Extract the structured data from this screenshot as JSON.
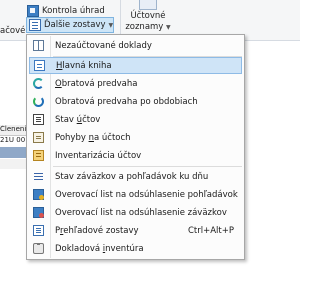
{
  "ribbon": {
    "kontrola_label": "Kontrola úhrad",
    "dalsie_label": "Ďalšie zostavy",
    "uctove_line1": "Účtovné",
    "uctove_line2": "zoznamy",
    "dropdown_chevron": "▼",
    "left_partial_label": "ačové"
  },
  "grid": {
    "header_partial": "Členenie",
    "row1_partial": "21U 00"
  },
  "menu": {
    "items": [
      {
        "pre": "Nezaúčtované doklady",
        "u": "",
        "post": "",
        "shortcut": "",
        "icon": "book-icon"
      },
      {
        "pre": "",
        "u": "H",
        "post": "lavná kniha",
        "shortcut": "",
        "icon": "notebook-icon"
      },
      {
        "pre": "",
        "u": "O",
        "post": "bratová predvaha",
        "shortcut": "",
        "icon": "turnover-icon"
      },
      {
        "pre": "Obratová predvaha po obdobiach",
        "u": "",
        "post": "",
        "shortcut": "",
        "icon": "turnover-period-icon"
      },
      {
        "pre": "Stav ",
        "u": "ú",
        "post": "čtov",
        "shortcut": "",
        "icon": "ledger-icon"
      },
      {
        "pre": "Pohyby ",
        "u": "n",
        "post": "a účtoch",
        "shortcut": "",
        "icon": "document-icon"
      },
      {
        "pre": "Inventarizácia účtov",
        "u": "",
        "post": "",
        "shortcut": "",
        "icon": "inventory-icon"
      },
      {
        "pre": "Stav záväzkov a pohľadávok ku dňu",
        "u": "",
        "post": "",
        "shortcut": "",
        "icon": "balance-lines-icon"
      },
      {
        "pre": "Overovací list na odsúhlasenie pohľadávok",
        "u": "",
        "post": "",
        "shortcut": "",
        "icon": "verify-receivables-icon"
      },
      {
        "pre": "Overovací list na odsúhlasenie záväzkov",
        "u": "",
        "post": "",
        "shortcut": "",
        "icon": "verify-payables-icon"
      },
      {
        "pre": "P",
        "u": "r",
        "post": "ehľadové zostavy",
        "shortcut": "Ctrl+Alt+P",
        "icon": "overview-icon"
      },
      {
        "pre": "Dokladová ",
        "u": "i",
        "post": "nventúra",
        "shortcut": "",
        "icon": "clipboard-icon"
      }
    ]
  },
  "colors": {
    "highlight_bg": "#cfe4f7",
    "highlight_border": "#8ebbe6",
    "menu_bg": "#fcfcfc",
    "ribbon_bg": "#f5f6f7"
  }
}
